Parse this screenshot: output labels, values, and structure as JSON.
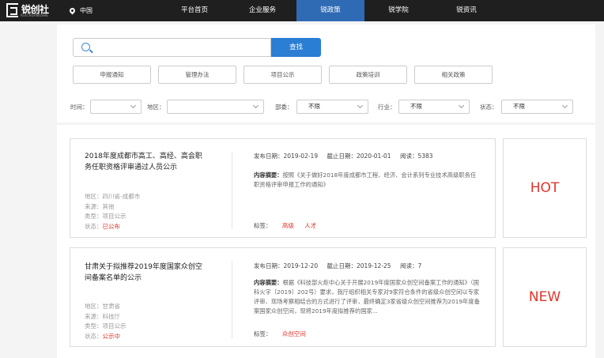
{
  "brand": {
    "name": "锐创社",
    "sub": "RUICHUANGSHE"
  },
  "location": "中国",
  "nav": [
    {
      "label": "平台首页",
      "active": false
    },
    {
      "label": "企业服务",
      "active": false
    },
    {
      "label": "锐政策",
      "active": true
    },
    {
      "label": "锐学院",
      "active": false
    },
    {
      "label": "锐资讯",
      "active": false
    }
  ],
  "search": {
    "placeholder": "",
    "button": "查找"
  },
  "categories": [
    "申报通知",
    "管理办法",
    "项目公示",
    "政策培训",
    "相关政策"
  ],
  "filters": {
    "time": {
      "label": "时间：",
      "value": ""
    },
    "region": {
      "label": "地区：",
      "value": ""
    },
    "dept": {
      "label": "部委：",
      "value": "不限"
    },
    "industry": {
      "label": "行业：",
      "value": "不限"
    },
    "status": {
      "label": "状态：",
      "value": "不限"
    }
  },
  "labels": {
    "publish": "发布日期：",
    "deadline": "截止日期：",
    "reads": "阅读：",
    "summary": "内容摘要：",
    "tags": "标签：",
    "region": "地区：",
    "source": "来源：",
    "type": "类型：",
    "status": "状态："
  },
  "results": [
    {
      "title": "2018年度成都市高工、高经、高会职务任职资格评审通过人员公示",
      "region": "四川省-成都市",
      "source": "其他",
      "type": "项目公示",
      "status": "已公布",
      "publish_date": "2019-02-19",
      "deadline": "2020-01-01",
      "reads": "5383",
      "summary": "按照《关于做好2018年度成都市工程、经济、会计系列专业技术高级职务任职资格评审申报工作的通知》",
      "tags": [
        "高级",
        "人才"
      ],
      "badge": "HOT"
    },
    {
      "title": "甘肃关于拟推荐2019年度国家众创空间备案名单的公示",
      "region": "甘肃省",
      "source": "科技厅",
      "type": "项目公示",
      "status": "公示中",
      "publish_date": "2019-12-20",
      "deadline": "2019-12-25",
      "reads": "7",
      "summary": "根据《科技部火炬中心关于开展2019年度国家众创空间备案工作的通知》（国科火字〔2019〕202号）要求，我厅组织相关专家对9家符合条件的省级众创空间以专家评审、现场考察相结合的方式进行了评审，最终确定3家省级众创空间推荐为2019年度备案国家众创空间，现将2019年度拟推荐的国家...",
      "tags": [
        "众创空间"
      ],
      "badge": "NEW"
    }
  ]
}
